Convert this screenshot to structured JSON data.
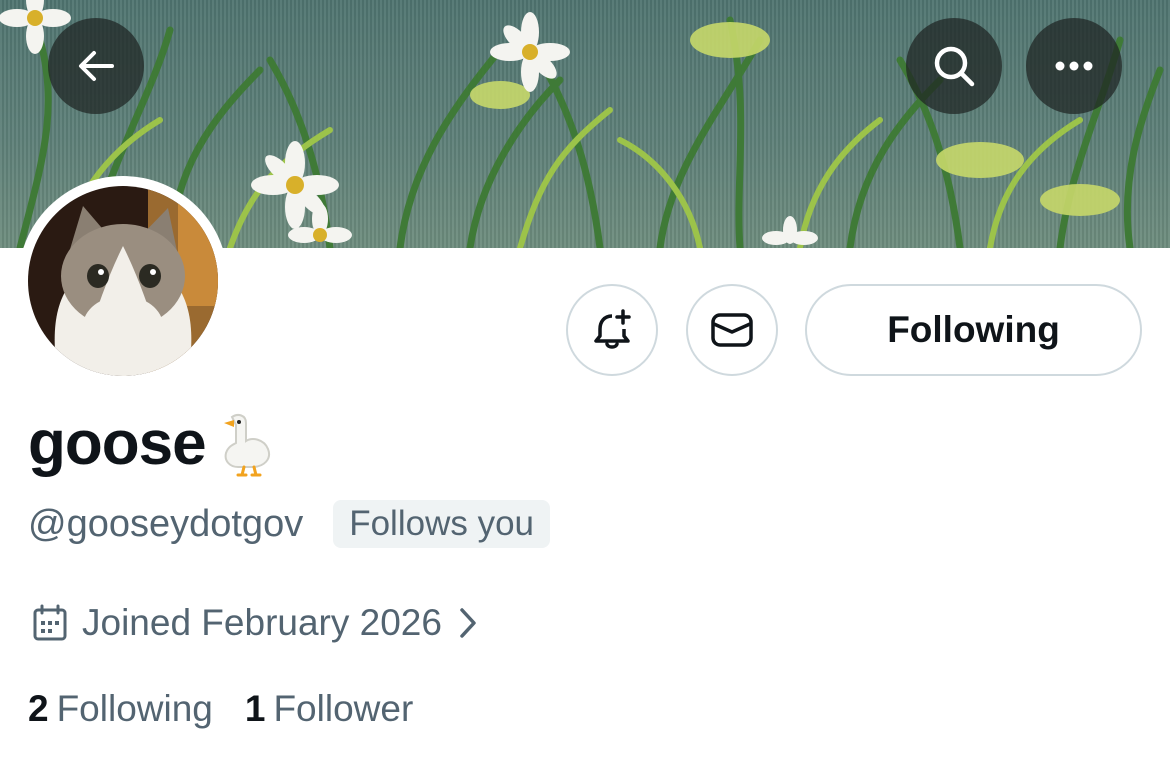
{
  "header": {
    "back_icon": "arrow-left-icon",
    "search_icon": "search-icon",
    "more_icon": "more-horizontal-icon"
  },
  "actions": {
    "notify_icon": "bell-plus-icon",
    "message_icon": "envelope-icon",
    "following_label": "Following"
  },
  "profile": {
    "display_name": "goose",
    "name_emoji": "goose-emoji",
    "handle": "@gooseydotgov",
    "follows_you": "Follows you",
    "joined": "Joined February 2026",
    "joined_icon": "calendar-icon",
    "stats": {
      "following_count": "2",
      "following_label": "Following",
      "followers_count": "1",
      "followers_label": "Follower"
    }
  },
  "colors": {
    "text_primary": "#0f1419",
    "text_secondary": "#536471",
    "border": "#cfd9de",
    "badge_bg": "#eff3f4",
    "banner": "#5d7f78"
  }
}
